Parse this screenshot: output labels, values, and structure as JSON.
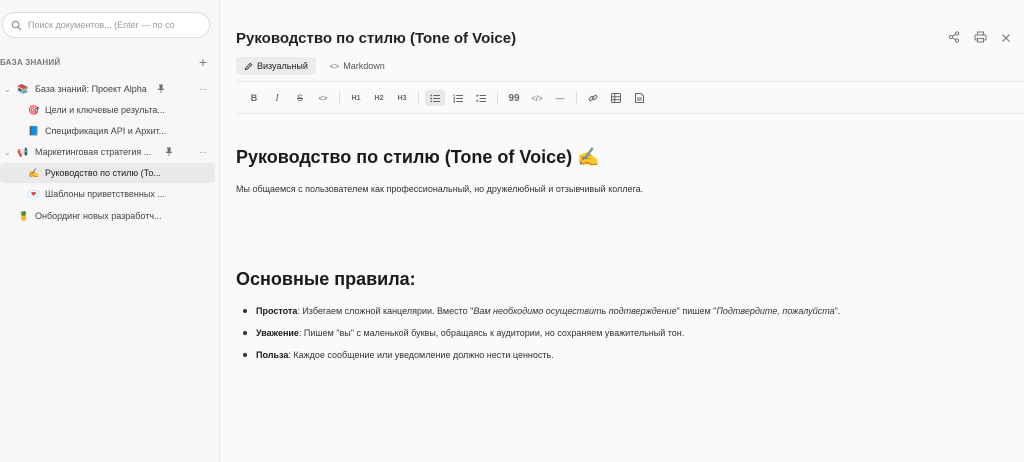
{
  "search": {
    "placeholder": "Поиск документов... (Enter — по со"
  },
  "sidebar": {
    "section_label": "БАЗА ЗНАНИЙ",
    "add_icon": "plus",
    "items": [
      {
        "label": "База знаний: Проект Alpha",
        "emoji": "📚",
        "chevron": "⌄",
        "pinned": true,
        "more": true
      },
      {
        "label": "Цели и ключевые результа...",
        "emoji": "🎯"
      },
      {
        "label": "Спецификация API и Архит...",
        "emoji": "📘"
      },
      {
        "label": "Маркетинговая стратегия ...",
        "emoji": "📢",
        "chevron": "⌄",
        "pinned": true,
        "more": true
      },
      {
        "label": "Руководство по стилю (То...",
        "emoji": "✍️",
        "active": true
      },
      {
        "label": "Шаблоны приветственных ...",
        "emoji": "💌"
      },
      {
        "label": "Онбординг новых разработч...",
        "emoji": "🍍"
      }
    ]
  },
  "document": {
    "title": "Руководство по стилю (Tone of Voice)",
    "modes": {
      "visual": "Визуальный",
      "markdown": "Markdown"
    },
    "heading1": "Руководство по стилю (Tone of Voice) ✍️",
    "intro": "Мы общаемся с пользователем как профессиональный, но дружелюбный и отзывчивый коллега.",
    "heading2": "Основные правила:",
    "rules": [
      {
        "term": "Простота",
        "t1": ": Избегаем сложной канцелярии. Вместо \"",
        "q1": "Вам необходимо осуществить подтверждение",
        "t2": "\" пишем \"",
        "q2": "Подтвердите, пожалуйста",
        "t3": "\"."
      },
      {
        "term": "Уважение",
        "t1": ": Пишем \"вы\" с маленькой буквы, обращаясь к аудитории, но сохраняем уважительный тон."
      },
      {
        "term": "Польза",
        "t1": ": Каждое сообщение или уведомление должно нести ценность."
      }
    ]
  },
  "toolbar": {
    "bold": "B",
    "italic": "I",
    "strike": "S",
    "code": "<>",
    "h1": "H1",
    "h2": "H2",
    "h3": "H3",
    "quote": "99",
    "codeblock": "</>",
    "hr": "—"
  },
  "colors": {
    "accent": "#222222",
    "active_bg": "#e9e9e9"
  }
}
